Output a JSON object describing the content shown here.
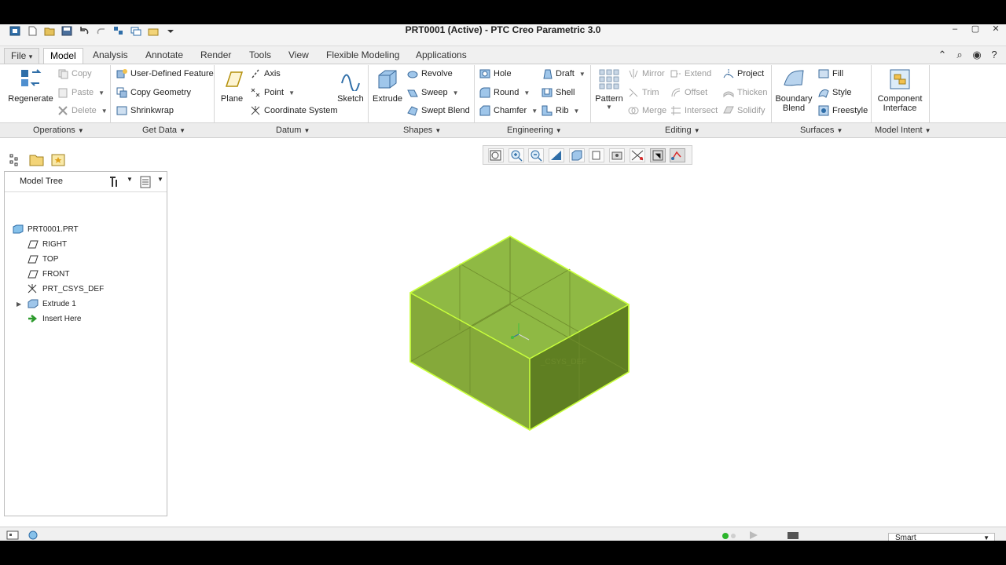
{
  "window": {
    "title": "PRT0001 (Active) - PTC Creo Parametric 3.0",
    "controls": [
      "–",
      "▢",
      "✕"
    ]
  },
  "menu": {
    "tabs": [
      "File",
      "Model",
      "Analysis",
      "Annotate",
      "Render",
      "Tools",
      "View",
      "Flexible Modeling",
      "Applications"
    ],
    "active": "Model",
    "file_arrow": "▾"
  },
  "ribbon": {
    "operations": {
      "regenerate": "Regenerate",
      "copy": "Copy",
      "paste": "Paste",
      "delete": "Delete"
    },
    "get_data": {
      "user_defined_feature": "User-Defined Feature",
      "copy_geometry": "Copy Geometry",
      "shrinkwrap": "Shrinkwrap"
    },
    "datum": {
      "plane": "Plane",
      "axis": "Axis",
      "point": "Point",
      "coordinate_system": "Coordinate System",
      "sketch": "Sketch"
    },
    "shapes": {
      "extrude": "Extrude",
      "revolve": "Revolve",
      "sweep": "Sweep",
      "swept_blend": "Swept Blend"
    },
    "engineering": {
      "hole": "Hole",
      "round": "Round",
      "chamfer": "Chamfer",
      "draft": "Draft",
      "shell": "Shell",
      "rib": "Rib"
    },
    "editing": {
      "pattern": "Pattern",
      "mirror": "Mirror",
      "trim": "Trim",
      "merge": "Merge",
      "extend": "Extend",
      "offset": "Offset",
      "intersect": "Intersect",
      "project": "Project",
      "thicken": "Thicken",
      "solidify": "Solidify"
    },
    "surfaces": {
      "boundary_blend_1": "Boundary",
      "boundary_blend_2": "Blend",
      "fill": "Fill",
      "style": "Style",
      "freestyle": "Freestyle"
    },
    "model_intent": {
      "component_interface_1": "Component",
      "component_interface_2": "Interface"
    },
    "groups": [
      "Operations",
      "Get Data",
      "Datum",
      "Shapes",
      "Engineering",
      "Editing",
      "Surfaces",
      "Model Intent"
    ]
  },
  "model_tree": {
    "title": "Model Tree",
    "items": [
      "PRT0001.PRT",
      "RIGHT",
      "TOP",
      "FRONT",
      "PRT_CSYS_DEF",
      "Extrude 1",
      "Insert Here"
    ]
  },
  "viewport": {
    "csys_label": "_CSYS_DEF",
    "model_color": "#8db53f",
    "edge_color": "#c8ff3c"
  },
  "status": {
    "filter": "Smart"
  }
}
